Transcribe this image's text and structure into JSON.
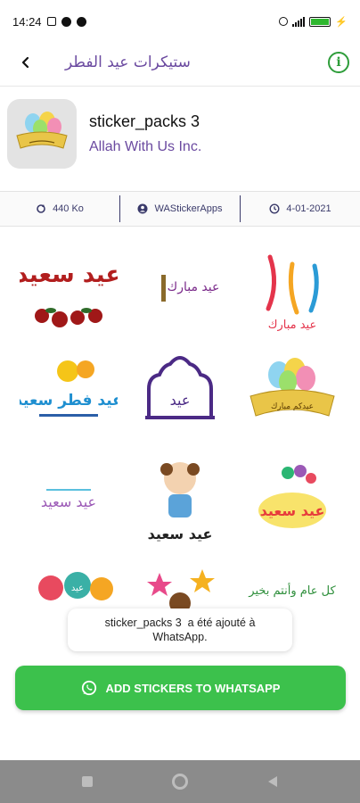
{
  "status_bar": {
    "time": "14:24",
    "battery_percent": 95
  },
  "app_bar": {
    "title": "ستيكرات عيد الفطر"
  },
  "pack": {
    "name": "sticker_packs 3",
    "publisher": "Allah With Us Inc."
  },
  "info": {
    "size": "440 Ko",
    "website": "WAStickerApps",
    "date": "4-01-2021"
  },
  "stickers": [
    {
      "text": "عيد سعيد",
      "accent": "#b21e1e"
    },
    {
      "text": "عيد مبارك",
      "accent": "#f5a623"
    },
    {
      "text": "عيد مبارك",
      "accent": "#e4344b"
    },
    {
      "text": "عيد فطر سعيد",
      "accent": "#1f8fd0"
    },
    {
      "text": "عيد",
      "accent": "#4b2a85"
    },
    {
      "text": "عيدكم مبارك",
      "accent": "#c9a227"
    },
    {
      "text": "عيد سعيد",
      "accent": "#9b59b6"
    },
    {
      "text": "عيد سعيد",
      "accent": "#222222"
    },
    {
      "text": "عيد سعيد",
      "accent": "#e73c3c"
    },
    {
      "text": "عيد",
      "accent": "#e84a5f"
    },
    {
      "text": "",
      "accent": "#f5b120"
    },
    {
      "text": "كل عام وأنتم بخير",
      "accent": "#2f8f3c"
    }
  ],
  "toast": {
    "line1": "sticker_packs 3  a été ajouté à",
    "line2": "WhatsApp."
  },
  "add_button": {
    "label": "ADD STICKERS TO WHATSAPP"
  },
  "colors": {
    "accent_green": "#3cc14c",
    "title_purple": "#6b4aa0",
    "info_text": "#3a3a6a"
  }
}
